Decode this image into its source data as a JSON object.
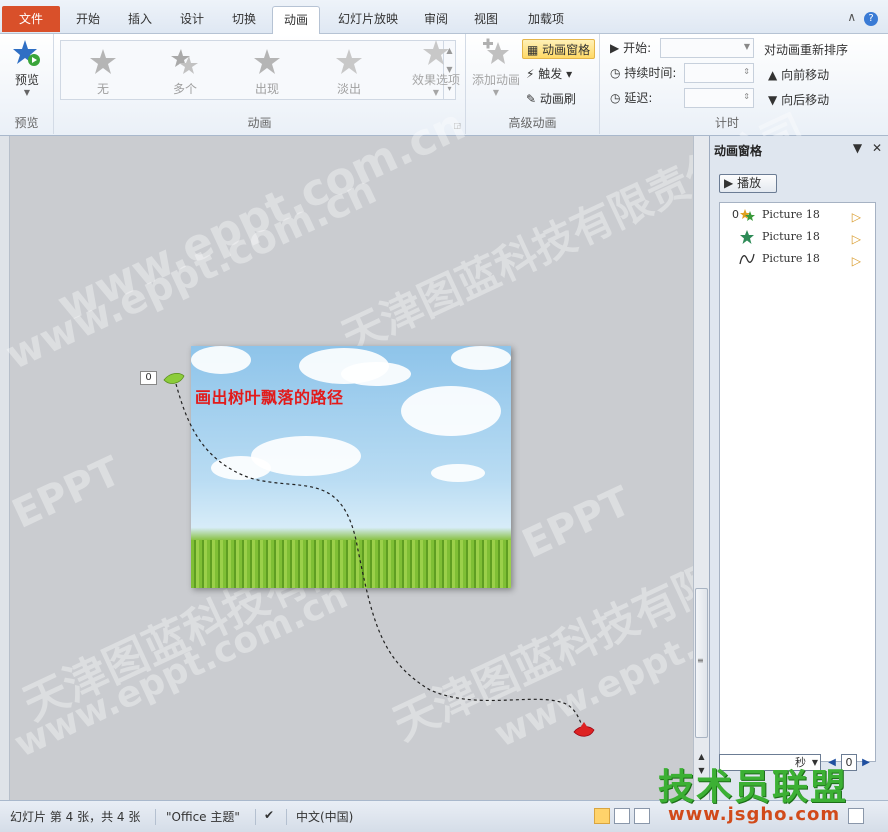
{
  "tabs": [
    {
      "label": "文件"
    },
    {
      "label": "开始"
    },
    {
      "label": "插入"
    },
    {
      "label": "设计"
    },
    {
      "label": "切换"
    },
    {
      "label": "动画"
    },
    {
      "label": "幻灯片放映"
    },
    {
      "label": "审阅"
    },
    {
      "label": "视图"
    },
    {
      "label": "加载项"
    }
  ],
  "ribbon": {
    "preview": {
      "button": "预览",
      "group": "预览"
    },
    "animation": {
      "items": [
        "无",
        "多个",
        "出现",
        "淡出"
      ],
      "effect_options": "效果选项",
      "group": "动画"
    },
    "advanced": {
      "add_animation": "添加动画",
      "animation_pane": "动画窗格",
      "trigger": "触发",
      "painter": "动画刷",
      "group": "高级动画"
    },
    "timing": {
      "start": "开始:",
      "duration": "持续时间:",
      "delay": "延迟:",
      "reorder": "对动画重新排序",
      "move_earlier": "向前移动",
      "move_later": "向后移动",
      "group": "计时"
    }
  },
  "slide": {
    "title": "画出树叶飘落的路径",
    "tag": "0"
  },
  "pane": {
    "title": "动画窗格",
    "play": "播放",
    "items": [
      {
        "num": "0",
        "name": "Picture 18",
        "icon": "multiple-effect-icon"
      },
      {
        "num": "",
        "name": "Picture 18",
        "icon": "green-star-icon"
      },
      {
        "num": "",
        "name": "Picture 18",
        "icon": "motion-path-icon"
      }
    ],
    "seconds": "秒",
    "zero": "0"
  },
  "status": {
    "slide_info": "幻灯片 第 4 张，共 4 张",
    "theme": "\"Office 主题\"",
    "language": "中文(中国)"
  },
  "watermarks": {
    "company": "天津图蓝科技有限责任公司",
    "url": "www.eppt.com.cn",
    "brand": "EPPT",
    "logo_text": "技术员联盟",
    "logo_url": "www.jsgho.com"
  },
  "colors": {
    "file_tab": "#d9502a",
    "accent_highlight": "#ffd966",
    "title_red": "#e21b1b"
  }
}
